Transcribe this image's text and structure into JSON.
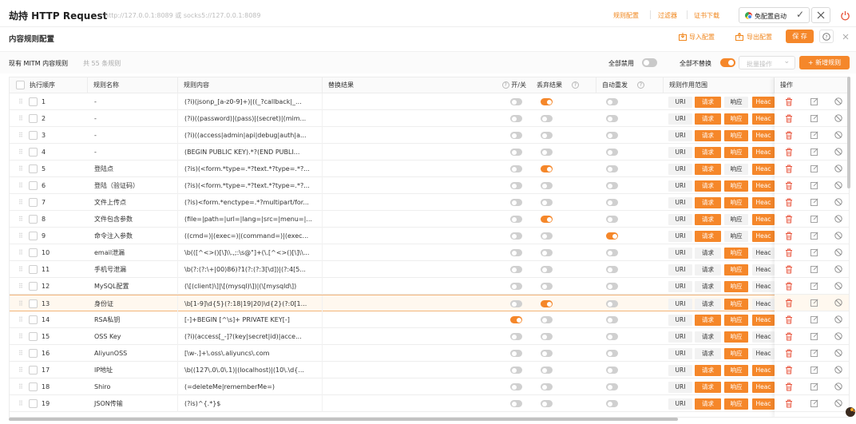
{
  "titlebar": {
    "title": "劫持 HTTP Request",
    "proxy_address": "http://127.0.0.1:8089 或 socks5://127.0.0.1:8089",
    "links": [
      "规则配置",
      "过滤器",
      "证书下载"
    ],
    "status_label": "免配置启动"
  },
  "subbar": {
    "title": "内容规则配置",
    "import_label": "导入配置",
    "export_label": "导出配置",
    "save_label": "保 存"
  },
  "toolbar": {
    "section_label": "现有 MITM 内容规则",
    "count_label": "共 55 条规则",
    "disable_all_label": "全部禁用",
    "disable_all_on": false,
    "no_replace_label": "全部不替换",
    "no_replace_on": true,
    "batch_placeholder": "批量操作",
    "add_label": "+ 新增规则"
  },
  "table": {
    "headers": {
      "order": "执行顺序",
      "name": "规则名称",
      "content": "规则内容",
      "replace": "替换结果",
      "toggle": "开/关",
      "save_result": "丢弃结果",
      "auto_resend": "自动重发",
      "scope": "规则作用范围",
      "ops": "操作"
    },
    "scope_labels": [
      "URI",
      "请求",
      "响应",
      "Heac"
    ],
    "rows": [
      {
        "order": "1",
        "name": "-",
        "content": "(?i)(jsonp_[a-z0-9]+)|((_?callback|_...",
        "enabled": false,
        "save": true,
        "resend": false,
        "scope": [
          false,
          true,
          false,
          true
        ],
        "highlight": false
      },
      {
        "order": "2",
        "name": "-",
        "content": "(?i)((password)|(pass)|(secret)|(mim...",
        "enabled": false,
        "save": false,
        "resend": false,
        "scope": [
          false,
          true,
          true,
          true
        ],
        "highlight": false
      },
      {
        "order": "3",
        "name": "-",
        "content": "(?i)((access|admin|api|debug|auth|a...",
        "enabled": false,
        "save": false,
        "resend": false,
        "scope": [
          false,
          true,
          true,
          true
        ],
        "highlight": false
      },
      {
        "order": "4",
        "name": "-",
        "content": "(BEGIN PUBLIC KEY).*?(END PUBLI...",
        "enabled": false,
        "save": false,
        "resend": false,
        "scope": [
          false,
          true,
          true,
          true
        ],
        "highlight": false
      },
      {
        "order": "5",
        "name": "登陆点",
        "content": "(?is)(<form.*type=.*?text.*?type=.*?...",
        "enabled": false,
        "save": true,
        "resend": false,
        "scope": [
          false,
          true,
          false,
          true
        ],
        "highlight": false
      },
      {
        "order": "6",
        "name": "登陆（验证码）",
        "content": "(?is)(<form.*type=.*?text.*?type=.*?...",
        "enabled": false,
        "save": false,
        "resend": false,
        "scope": [
          false,
          true,
          true,
          true
        ],
        "highlight": false
      },
      {
        "order": "7",
        "name": "文件上传点",
        "content": "(?is)<form.*enctype=.*?multipart/for...",
        "enabled": false,
        "save": false,
        "resend": false,
        "scope": [
          false,
          true,
          true,
          true
        ],
        "highlight": false
      },
      {
        "order": "8",
        "name": "文件包含参数",
        "content": "(file=|path=|url=|lang=|src=|menu=|...",
        "enabled": false,
        "save": true,
        "resend": false,
        "scope": [
          false,
          true,
          false,
          true
        ],
        "highlight": false
      },
      {
        "order": "9",
        "name": "命令注入参数",
        "content": "((cmd=)|(exec=)|(command=)|(exec...",
        "enabled": false,
        "save": false,
        "resend": true,
        "scope": [
          false,
          true,
          false,
          true
        ],
        "highlight": false
      },
      {
        "order": "10",
        "name": "email泄漏",
        "content": "\\b(([^<>()[\\]\\\\.,;:\\s@\"]+(\\.[^<>()[\\]\\\\...",
        "enabled": false,
        "save": false,
        "resend": false,
        "scope": [
          false,
          false,
          true,
          false
        ],
        "highlight": false
      },
      {
        "order": "11",
        "name": "手机号泄漏",
        "content": "\\b(?:(?:\\+|00)86)?1(?:(?:3[\\d])|(?:4[5...",
        "enabled": false,
        "save": false,
        "resend": false,
        "scope": [
          false,
          false,
          true,
          false
        ],
        "highlight": false
      },
      {
        "order": "12",
        "name": "MySQL配置",
        "content": "(\\[(client)\\]|\\[(mysql)\\])|(\\[mysqld\\])",
        "enabled": false,
        "save": false,
        "resend": false,
        "scope": [
          false,
          false,
          true,
          false
        ],
        "highlight": false
      },
      {
        "order": "13",
        "name": "身份证",
        "content": "\\b[1-9]\\d{5}(?:18|19|20)\\d{2}(?:0[1...",
        "enabled": false,
        "save": true,
        "resend": false,
        "scope": [
          false,
          false,
          true,
          false
        ],
        "highlight": true
      },
      {
        "order": "14",
        "name": "RSA私钥",
        "content": "[-]+BEGIN [^\\s]+ PRIVATE KEY[-]",
        "enabled": true,
        "save": false,
        "resend": false,
        "scope": [
          false,
          true,
          true,
          true
        ],
        "highlight": false
      },
      {
        "order": "15",
        "name": "OSS Key",
        "content": "(?i)(access[_-]?(key|secret|id)|acce...",
        "enabled": false,
        "save": false,
        "resend": false,
        "scope": [
          false,
          false,
          true,
          false
        ],
        "highlight": false
      },
      {
        "order": "16",
        "name": "AliyunOSS",
        "content": "[\\w-.]+\\.oss\\.aliyuncs\\.com",
        "enabled": false,
        "save": false,
        "resend": false,
        "scope": [
          false,
          false,
          true,
          false
        ],
        "highlight": false
      },
      {
        "order": "17",
        "name": "IP地址",
        "content": "\\b((127\\.0\\.0\\.1)|(localhost)|(10\\.\\d{...",
        "enabled": false,
        "save": false,
        "resend": false,
        "scope": [
          false,
          true,
          true,
          true
        ],
        "highlight": false
      },
      {
        "order": "18",
        "name": "Shiro",
        "content": "(=deleteMe|rememberMe=)",
        "enabled": false,
        "save": false,
        "resend": false,
        "scope": [
          false,
          true,
          true,
          true
        ],
        "highlight": false
      },
      {
        "order": "19",
        "name": "JSON传输",
        "content": "(?is)^{.*}$",
        "enabled": false,
        "save": false,
        "resend": false,
        "scope": [
          false,
          true,
          true,
          true
        ],
        "highlight": false
      }
    ]
  },
  "colors": {
    "accent": "#f5872a",
    "link": "#f0861c",
    "delete": "#e8533b",
    "row_highlight": "#fff8ef"
  }
}
